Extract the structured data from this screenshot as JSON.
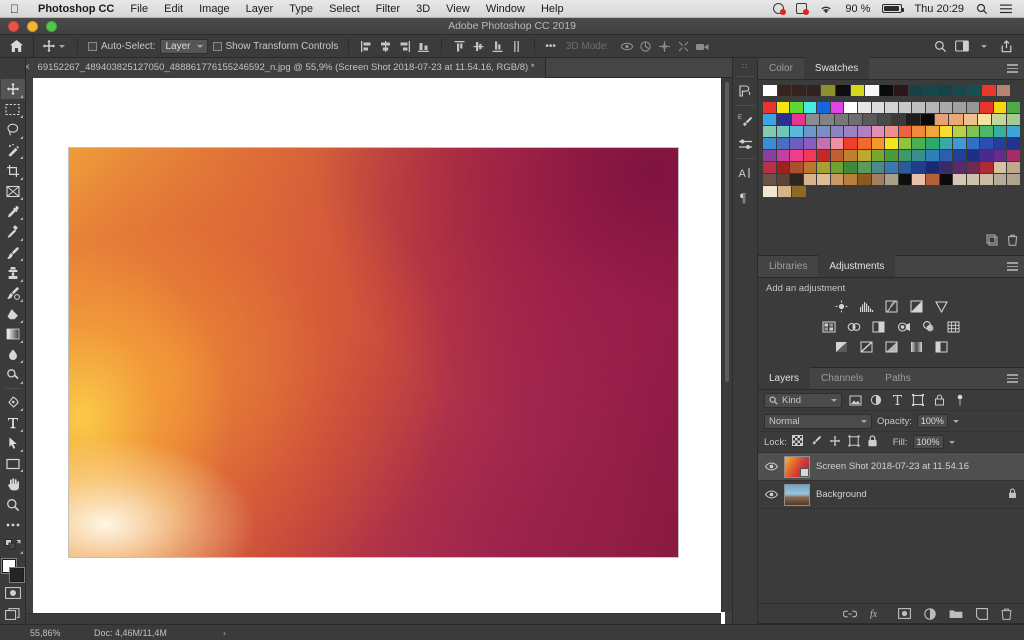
{
  "macos_menubar": {
    "apple_icon": "apple-icon",
    "items": [
      {
        "label": "Photoshop CC",
        "bold": true
      },
      {
        "label": "File",
        "bold": false
      },
      {
        "label": "Edit",
        "bold": false
      },
      {
        "label": "Image",
        "bold": false
      },
      {
        "label": "Layer",
        "bold": false
      },
      {
        "label": "Type",
        "bold": false
      },
      {
        "label": "Select",
        "bold": false
      },
      {
        "label": "Filter",
        "bold": false
      },
      {
        "label": "3D",
        "bold": false
      },
      {
        "label": "View",
        "bold": false
      },
      {
        "label": "Window",
        "bold": false
      },
      {
        "label": "Help",
        "bold": false
      }
    ],
    "status": {
      "battery_percent": "90 %",
      "clock": "Thu 20:29",
      "icons": [
        "dropbox-icon",
        "notification-icon",
        "wifi-icon",
        "battery-icon",
        "spotlight-search-icon",
        "control-center-icon"
      ]
    }
  },
  "window": {
    "title": "Adobe Photoshop CC 2019",
    "traffic_lights": [
      "close-button",
      "minimize-button",
      "zoom-button"
    ]
  },
  "options_bar": {
    "home_icon": "home-icon",
    "tool_icon": "move-tool-icon",
    "auto_select_label": "Auto-Select:",
    "auto_select_value": "Layer",
    "show_transform_label": "Show Transform Controls",
    "align_icons": [
      "align-left-edges-icon",
      "align-horizontal-centers-icon",
      "align-right-edges-icon",
      "align-top-edges-icon"
    ],
    "distribute_icons": [
      "distribute-top-icon",
      "distribute-vertical-centers-icon",
      "distribute-bottom-icon",
      "distribute-spacing-icon"
    ],
    "more_label": "•••",
    "three_d_mode_label": "3D Mode:",
    "three_d_icons": [
      "rotate-3d-icon",
      "roll-3d-icon",
      "pan-3d-icon",
      "slide-3d-icon",
      "camera-3d-icon"
    ],
    "right_icons": [
      "search-icon",
      "workspace-switcher-icon",
      "share-icon"
    ]
  },
  "document_tab": {
    "close_icon": "close-icon",
    "title": "69152267_489403825127050_488861776155246592_n.jpg @ 55,9% (Screen Shot 2018-07-23 at 11.54.16, RGB/8) *"
  },
  "toolbar": {
    "tools": [
      {
        "name": "move-tool",
        "active": true
      },
      {
        "name": "rectangular-marquee-tool",
        "active": false
      },
      {
        "name": "lasso-tool",
        "active": false
      },
      {
        "name": "quick-selection-tool",
        "active": false
      },
      {
        "name": "crop-tool",
        "active": false
      },
      {
        "name": "frame-tool",
        "active": false
      },
      {
        "name": "eyedropper-tool",
        "active": false
      },
      {
        "name": "spot-healing-brush-tool",
        "active": false
      },
      {
        "name": "brush-tool",
        "active": false
      },
      {
        "name": "clone-stamp-tool",
        "active": false
      },
      {
        "name": "history-brush-tool",
        "active": false
      },
      {
        "name": "eraser-tool",
        "active": false
      },
      {
        "name": "gradient-tool",
        "active": false
      },
      {
        "name": "blur-tool",
        "active": false
      },
      {
        "name": "dodge-tool",
        "active": false
      },
      {
        "name": "pen-tool",
        "active": false
      },
      {
        "name": "horizontal-type-tool",
        "active": false
      },
      {
        "name": "path-selection-tool",
        "active": false
      },
      {
        "name": "rectangle-tool",
        "active": false
      },
      {
        "name": "hand-tool",
        "active": false
      },
      {
        "name": "zoom-tool",
        "active": false
      },
      {
        "name": "edit-toolbar-tool",
        "active": false
      }
    ],
    "foreground_color": "#ffffff",
    "background_color": "#2b2321",
    "quick_mask_icon": "quick-mask-icon",
    "screen_mode_icon": "screen-mode-icon"
  },
  "canvas": {
    "image_alt": "orange-to-magenta-gradient-photo",
    "gradient_colors": [
      "#f0a23c",
      "#dd6a38",
      "#c4443f",
      "#a82a55",
      "#7d1240"
    ]
  },
  "status_bar": {
    "zoom": "55,86%",
    "doc_info": "Doc: 4,46M/11,4M",
    "arrow": "›"
  },
  "icon_dock": {
    "icons": [
      "history-panel-icon",
      "brush-panel-icon",
      "brush-settings-panel-icon",
      "character-panel-icon",
      "paragraph-panel-icon"
    ]
  },
  "swatches_panel": {
    "tabs": [
      {
        "label": "Color",
        "active": false
      },
      {
        "label": "Swatches",
        "active": true
      }
    ],
    "menu_icon": "panel-menu-icon",
    "recent_row": [
      "#ffffff",
      "#3a2220",
      "#34221f",
      "#32211d",
      "#8f8f2d",
      "#0d0d0d",
      "#d4d81c",
      "#f7f7f7",
      "#0a0a0a",
      "#2d1416",
      "#174143",
      "#16484a",
      "#154446",
      "#174a4c",
      "#165052",
      "#e8372c",
      "#b78470"
    ],
    "rows": [
      [
        "#e8342a",
        "#f5e312",
        "#5ed634",
        "#49e8e0",
        "#1564e0",
        "#e043e8",
        "#ffffff",
        "#e6e6e6",
        "#dcdcdc",
        "#d2d2d2",
        "#c8c8c8",
        "#bebebe",
        "#b4b4b4",
        "#aaaaaa",
        "#a0a0a0",
        "#969696",
        "#e8342a",
        "#f5d812",
        "#4fa84a"
      ],
      [
        "#3aa4e0",
        "#2b2f92",
        "#e8348c",
        "#8c8c8c",
        "#828282",
        "#787878",
        "#6e6e6e",
        "#5a5a5a",
        "#4a4a4a",
        "#3a3a3a",
        "#1e1e1e",
        "#0a0a0a",
        "#e8a076",
        "#eaa878",
        "#efc08e",
        "#f3e2a0",
        "#c4d69a",
        "#a8c98e"
      ],
      [
        "#86c7b0",
        "#6fc4bb",
        "#58b9d8",
        "#6f96c8",
        "#7a8fc4",
        "#8a86c2",
        "#9b82c0",
        "#b27fc0",
        "#e091b8",
        "#ef8f8f",
        "#ee6242",
        "#f08a3a",
        "#f0a63a",
        "#f5dd2a",
        "#b9d148",
        "#7fc24f",
        "#4eb86a",
        "#38b0a0",
        "#3ba6d4"
      ],
      [
        "#3a8fd4",
        "#4a6fc0",
        "#6b5ec0",
        "#8a5ec0",
        "#c86fb2",
        "#f08fa0",
        "#ef3f2a",
        "#f06a2a",
        "#f59a28",
        "#f7e220",
        "#8cc63f",
        "#4caf50",
        "#2fa86f",
        "#3aa8a8",
        "#3f9ad4",
        "#2f6fc4",
        "#2a4fb0",
        "#243f9a",
        "#1f3690"
      ],
      [
        "#8a3fa0",
        "#c43fa0",
        "#ef3f8a",
        "#ef3a5a",
        "#c62828",
        "#c06030",
        "#c08030",
        "#c0a830",
        "#78a832",
        "#4a9a3a",
        "#3a9a6a",
        "#3a8f8a",
        "#2f7fb8",
        "#2a5fb0",
        "#223f9a",
        "#1e2f86",
        "#4a2a8a",
        "#6a2a8a",
        "#a82a6a"
      ],
      [
        "#b8304a",
        "#a02020",
        "#a85030",
        "#b87830",
        "#a8a030",
        "#70a030",
        "#3f8a3a",
        "#5a9a5a",
        "#4a8a8a",
        "#3a78b0",
        "#2a5a9a",
        "#1f3f8a",
        "#1a2a72",
        "#3a2a6a",
        "#5a2a6a",
        "#6f2a54",
        "#b02a3a",
        "#d6c2a0",
        "#c0a88a"
      ],
      [
        "#6a5244",
        "#5a4438",
        "#2e2420",
        "#d8b48e",
        "#e0bc96",
        "#c89a66",
        "#b8803c",
        "#8a5a20",
        "#a08060",
        "#a8a088",
        "#0e0e0e",
        "#e8bfa8",
        "#b4603a",
        "#0a0a0a",
        "#d4c8b4",
        "#cfc0aa",
        "#c8bca4",
        "#b8ac98",
        "#b0a490"
      ],
      [
        "#efe6d4",
        "#d6b488",
        "#8a6a26"
      ]
    ]
  },
  "adjustments_panel": {
    "tabs": [
      {
        "label": "Libraries",
        "active": false
      },
      {
        "label": "Adjustments",
        "active": true
      }
    ],
    "menu_icon": "panel-menu-icon",
    "heading": "Add an adjustment",
    "rows": [
      [
        "brightness-contrast-icon",
        "levels-icon",
        "curves-icon",
        "exposure-icon",
        "vibrance-icon"
      ],
      [
        "hue-saturation-icon",
        "color-balance-icon",
        "black-white-icon",
        "photo-filter-icon",
        "channel-mixer-icon",
        "color-lookup-icon"
      ],
      [
        "invert-icon",
        "posterize-icon",
        "threshold-icon",
        "gradient-map-icon",
        "selective-color-icon"
      ]
    ]
  },
  "layers_panel": {
    "tabs": [
      {
        "label": "Layers",
        "active": true
      },
      {
        "label": "Channels",
        "active": false
      },
      {
        "label": "Paths",
        "active": false
      }
    ],
    "menu_icon": "panel-menu-icon",
    "filter": {
      "search_icon": "search-icon",
      "kind_label": "Kind",
      "type_icons": [
        "filter-pixel-icon",
        "filter-adjustment-icon",
        "filter-type-icon",
        "filter-shape-icon",
        "filter-smart-object-icon"
      ],
      "toggle_icon": "filter-toggle-icon"
    },
    "blend_mode": "Normal",
    "opacity_label": "Opacity:",
    "opacity_value": "100%",
    "lock_label": "Lock:",
    "lock_icons": [
      "lock-transparent-pixels-icon",
      "lock-image-pixels-icon",
      "lock-position-icon",
      "lock-artboard-nesting-icon",
      "lock-all-icon"
    ],
    "fill_label": "Fill:",
    "fill_value": "100%",
    "layers": [
      {
        "name": "Screen Shot 2018-07-23 at 11.54.16",
        "visible": true,
        "selected": true,
        "thumb": "gradient-thumbnail",
        "smart_object": true,
        "locked": false
      },
      {
        "name": "Background",
        "visible": true,
        "selected": false,
        "thumb": "photo-thumbnail",
        "smart_object": false,
        "locked": true
      }
    ],
    "footer_icons": [
      "link-layers-icon",
      "layer-style-fx-icon",
      "add-layer-mask-icon",
      "new-adjustment-layer-icon",
      "new-group-icon",
      "new-layer-icon",
      "delete-layer-icon"
    ]
  }
}
